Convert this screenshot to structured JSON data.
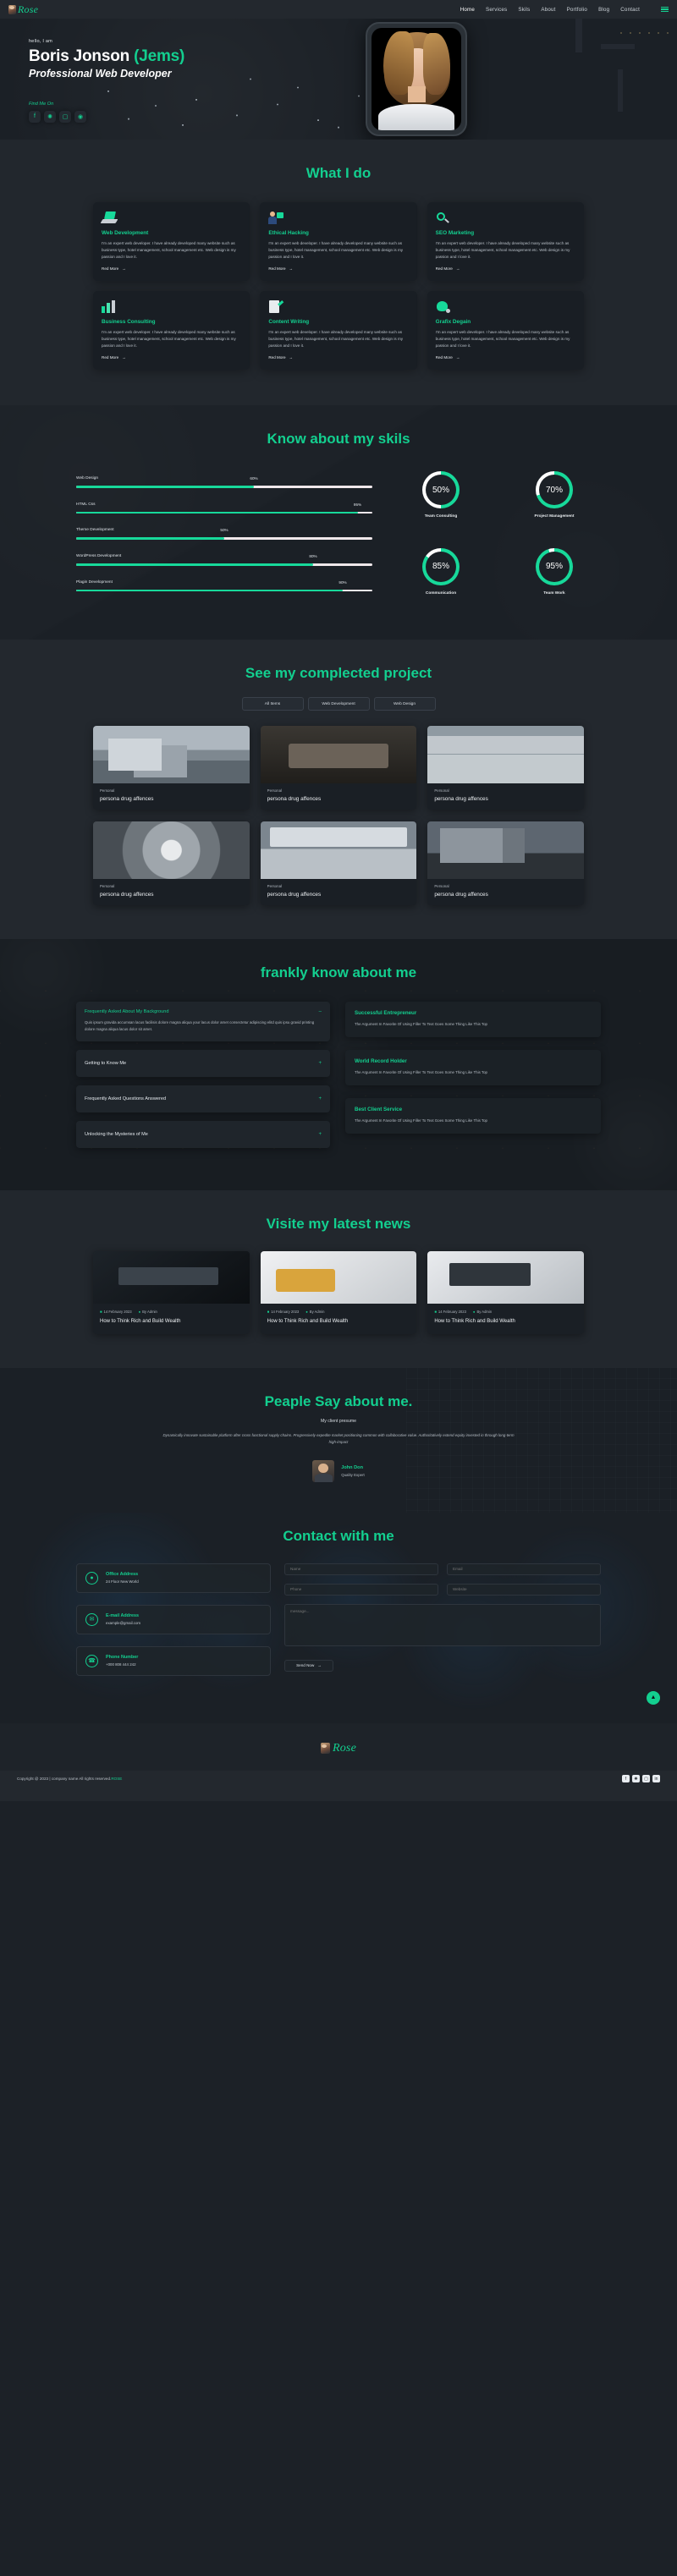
{
  "nav": {
    "brand": "Rose",
    "links": [
      "Home",
      "Services",
      "Skils",
      "About",
      "Portfolio",
      "Blog",
      "Contact"
    ],
    "menu_icon": "hamburger-icon"
  },
  "hero": {
    "greeting": "hello, I am",
    "name_main": "Boris Jonson",
    "name_accent": "(Jems)",
    "role": "Professional Web Developer",
    "find_me_on": "Find Me On",
    "socials": [
      "facebook-icon",
      "twitter-icon",
      "instagram-icon",
      "dribbble-icon"
    ]
  },
  "services": {
    "title_main": "What I",
    "title_accent": "do",
    "read_more": "Red More",
    "arrow": "→",
    "cards": [
      {
        "icon": "laptop-icon",
        "title": "Web Development",
        "body": "I'm an expert web developer. I have already developed many website such as business type, hotel management, school management etc. Web design is my passion and I love it."
      },
      {
        "icon": "ethical-hacking-icon",
        "title": "Ethical Hacking",
        "body": "I'm an expert web developer. I have already developed many website such as business type, hotel management, school management etc. Web design is my passion and I love it."
      },
      {
        "icon": "seo-icon",
        "title": "SEO Marketing",
        "body": "I'm an expert web developer. I have already developed many website such as business type, hotel management, school management etc. Web design is my passion and I love it."
      },
      {
        "icon": "chart-icon",
        "title": "Business Consulting",
        "body": "I'm an expert web developer. I have already developed many website such as business type, hotel management, school management etc. Web design is my passion and I love it."
      },
      {
        "icon": "writing-icon",
        "title": "Content Writing",
        "body": "I'm an expert web developer. I have already developed many website such as business type, hotel management, school management etc. Web design is my passion and I love it."
      },
      {
        "icon": "palette-icon",
        "title": "Grafix Degain",
        "body": "I'm an expert web developer. I have already developed many website such as business type, hotel management, school management etc. Web design is my passion and I love it."
      }
    ]
  },
  "skills": {
    "title_main": "Know about my",
    "title_accent": "skils",
    "chart_data": {
      "type": "bar",
      "title": "Know about my skils",
      "categories": [
        "Web Design",
        "HTML Css",
        "Theme Development",
        "WordPress Development",
        "Plagin Development"
      ],
      "values": [
        60,
        95,
        50,
        80,
        90
      ],
      "value_labels": [
        "60%",
        "95%",
        "50%",
        "80%",
        "90%"
      ],
      "xlabel": "",
      "ylabel": "",
      "ylim": [
        0,
        100
      ],
      "orientation": "horizontal",
      "bar_color": "#17d99a",
      "track_color": "#efe7ea",
      "circles": {
        "type": "pie",
        "categories": [
          "Team Consulting",
          "Project Management",
          "Communication",
          "Team Work"
        ],
        "values": [
          50,
          70,
          85,
          95
        ],
        "value_labels": [
          "50%",
          "70%",
          "85%",
          "95%"
        ],
        "arc_color": "#17d99a",
        "remainder_color": "#ffffff"
      }
    }
  },
  "projects": {
    "title_main": "See my complected",
    "title_accent": "project",
    "tabs": [
      "All Items",
      "Web Development",
      "Web Design"
    ],
    "items": [
      {
        "kind": "Personal",
        "name": "persona drug affences"
      },
      {
        "kind": "Personal",
        "name": "persona drug affences"
      },
      {
        "kind": "Personal",
        "name": "persona drug affences"
      },
      {
        "kind": "Personal",
        "name": "persona drug affences"
      },
      {
        "kind": "Personal",
        "name": "persona drug affences"
      },
      {
        "kind": "Personal",
        "name": "persona drug affences"
      }
    ]
  },
  "about": {
    "title_main": "frankly know about",
    "title_accent": "me",
    "accordion": [
      {
        "q": "Frequently Asked About My Background",
        "sign": "–",
        "open": true,
        "a": "Quis ipsum gravida accumsan lacus facilisis dolore magna aliqua your lacus dolor amet consectetur adipiscing elitd quis ipsu gravid printing dolore magna aliqua lacus dolor sit amet."
      },
      {
        "q": "Getting to Know Me",
        "sign": "+",
        "open": false,
        "a": ""
      },
      {
        "q": "Frequently Asked Questions Answered",
        "sign": "+",
        "open": false,
        "a": ""
      },
      {
        "q": "Unlocking the Mysteries of Me",
        "sign": "+",
        "open": false,
        "a": ""
      }
    ],
    "features": [
      {
        "title": "Successful Entrepreneur",
        "body": "The Argument In Favorite Of Using Filler To Text Goes Some Thing Like This Top"
      },
      {
        "title": "World Record Holder",
        "body": "The Argument In Favorite Of Using Filler To Text Goes Some Thing Like This Top"
      },
      {
        "title": "Best Client Service",
        "body": "The Argument In Favorite Of Using Filler To Text Goes Some Thing Like This Top"
      }
    ]
  },
  "news": {
    "title_main": "Visite my latest",
    "title_accent": "news",
    "items": [
      {
        "date": "14 February 2023",
        "author": "By Admin",
        "title": "How to Think Rich and Build Wealth"
      },
      {
        "date": "14 February 2023",
        "author": "By Admin",
        "title": "How to Think Rich and Build Wealth"
      },
      {
        "date": "14 February 2023",
        "author": "By Admin",
        "title": "How to Think Rich and Build Wealth"
      }
    ],
    "date_icon": "calendar-icon",
    "author_icon": "user-icon"
  },
  "testimonial": {
    "title_main": "Peaple Say about",
    "title_accent": "me.",
    "subtitle": "My client presume",
    "quote": "Dynamically innovate sustainable platform after cross functional supply chains. Progressively expedite market positioning common with collaborative value. Authoritatively extend equity invested in through long-term high-impact",
    "name": "John Don",
    "role": "Quality Expert"
  },
  "contact": {
    "title_main": "Contact with",
    "title_accent": "me",
    "info": [
      {
        "icon": "location-icon",
        "title": "Office Address",
        "value": "24 Floor New World"
      },
      {
        "icon": "mail-icon",
        "title": "E-mail Address",
        "value": "example@gmail.com"
      },
      {
        "icon": "phone-icon",
        "title": "Phone Number",
        "value": "+000 808 444 242"
      }
    ],
    "form": {
      "name_placeholder": "Name",
      "email_placeholder": "Email",
      "phone_placeholder": "Phone",
      "website_placeholder": "Website",
      "message_placeholder": "message...",
      "send_label": "Send Now",
      "send_arrow": "→"
    },
    "fab_icon": "scroll-top-icon"
  },
  "footer": {
    "brand": "Rose",
    "copyright": "Copyright @ 2023 | company name All rights reserved.",
    "brand_suffix": "ROSE",
    "socials": [
      "facebook-icon",
      "twitter-icon",
      "instagram-icon",
      "linkedin-icon"
    ]
  }
}
